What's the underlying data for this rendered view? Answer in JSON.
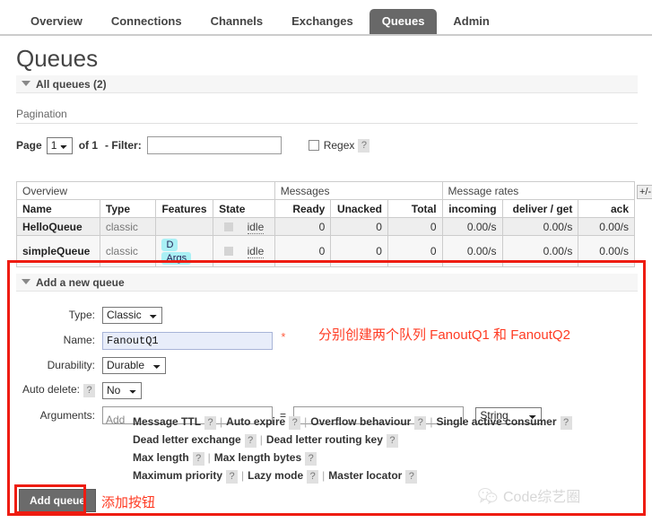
{
  "nav": {
    "tabs": [
      {
        "label": "Overview",
        "active": false
      },
      {
        "label": "Connections",
        "active": false
      },
      {
        "label": "Channels",
        "active": false
      },
      {
        "label": "Exchanges",
        "active": false
      },
      {
        "label": "Queues",
        "active": true
      },
      {
        "label": "Admin",
        "active": false
      }
    ]
  },
  "page": {
    "title": "Queues",
    "section_header": "All queues (2)"
  },
  "pagination": {
    "label": "Pagination",
    "page_label": "Page",
    "page_value": "1",
    "of_text": "of 1",
    "filter_label": "- Filter:",
    "filter_value": "",
    "regex_label": "Regex",
    "help": "?"
  },
  "table": {
    "group_headers": {
      "overview": "Overview",
      "messages": "Messages",
      "message_rates": "Message rates"
    },
    "columns": [
      "Name",
      "Type",
      "Features",
      "State",
      "Ready",
      "Unacked",
      "Total",
      "incoming",
      "deliver / get",
      "ack"
    ],
    "expand_toggle": "+/-",
    "rows": [
      {
        "name": "HelloQueue",
        "type": "classic",
        "features": [],
        "state": "idle",
        "ready": "0",
        "unacked": "0",
        "total": "0",
        "incoming": "0.00/s",
        "deliver_get": "0.00/s",
        "ack": "0.00/s"
      },
      {
        "name": "simpleQueue",
        "type": "classic",
        "features": [
          "D",
          "Args"
        ],
        "state": "idle",
        "ready": "0",
        "unacked": "0",
        "total": "0",
        "incoming": "0.00/s",
        "deliver_get": "0.00/s",
        "ack": "0.00/s"
      }
    ]
  },
  "add_queue": {
    "header": "Add a new queue",
    "type_label": "Type:",
    "type_value": "Classic",
    "name_label": "Name:",
    "name_value": "FanoutQ1",
    "required_mark": "*",
    "durability_label": "Durability:",
    "durability_value": "Durable",
    "auto_delete_label": "Auto delete:",
    "auto_delete_value": "No",
    "auto_delete_help": "?",
    "arguments_label": "Arguments:",
    "argument_key": "",
    "argument_value": "",
    "equals": "=",
    "argument_type": "String",
    "add_link": "Add",
    "presets": [
      [
        {
          "label": "Message TTL",
          "help": "?"
        },
        {
          "label": "Auto expire",
          "help": "?"
        },
        {
          "label": "Overflow behaviour",
          "help": "?"
        },
        {
          "label": "Single active consumer",
          "help": "?"
        }
      ],
      [
        {
          "label": "Dead letter exchange",
          "help": "?"
        },
        {
          "label": "Dead letter routing key",
          "help": "?"
        }
      ],
      [
        {
          "label": "Max length",
          "help": "?"
        },
        {
          "label": "Max length bytes",
          "help": "?"
        }
      ],
      [
        {
          "label": "Maximum priority",
          "help": "?"
        },
        {
          "label": "Lazy mode",
          "help": "?"
        },
        {
          "label": "Master locator",
          "help": "?"
        }
      ]
    ],
    "submit_label": "Add queue"
  },
  "annotations": {
    "form_note": "分别创建两个队列 FanoutQ1 和 FanoutQ2",
    "button_note": "添加按钮",
    "accent_color": "#ee1c11"
  },
  "watermark": {
    "text": "Code综艺圈"
  }
}
